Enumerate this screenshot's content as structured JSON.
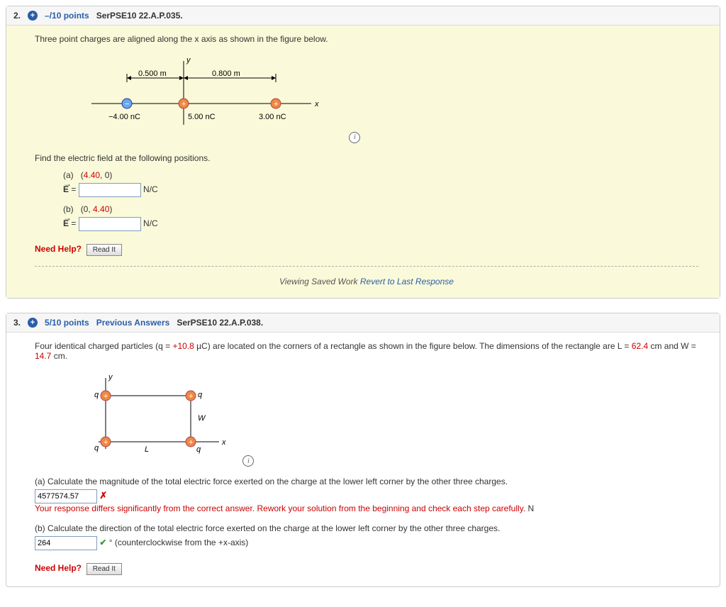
{
  "q2": {
    "number": "2.",
    "points": "–/10 points",
    "serial": "SerPSE10 22.A.P.035.",
    "intro": "Three point charges are aligned along the x axis as shown in the figure below.",
    "fig": {
      "d1": "0.500 m",
      "d2": "0.800 m",
      "c1": "−4.00 nC",
      "c2": "5.00 nC",
      "c3": "3.00 nC",
      "x": "x",
      "y": "y"
    },
    "find": "Find the electric field at the following positions.",
    "partA_label": "(a)",
    "partA_point_pre": "(",
    "partA_point_x": "4.40",
    "partA_point_rest": ", 0)",
    "partB_label": "(b)",
    "partB_point_pre": "(0, ",
    "partB_point_y": "4.40",
    "partB_point_suf": ")",
    "E_label": "E⃗ =",
    "unit": "N/C",
    "needHelp": "Need Help?",
    "readIt": "Read It",
    "revert_pre": "Viewing Saved Work ",
    "revert_link": "Revert to Last Response"
  },
  "q3": {
    "number": "3.",
    "points": "5/10 points",
    "prev": "Previous Answers",
    "serial": "SerPSE10 22.A.P.038.",
    "intro_pre": "Four identical charged particles (q = ",
    "q_val": "+10.8",
    "intro_mid1": " µC) are located on the corners of a rectangle as shown in the figure below. The dimensions of the rectangle are L = ",
    "L_val": "62.4",
    "intro_mid2": " cm and W = ",
    "W_val": "14.7",
    "intro_end": " cm.",
    "fig": {
      "q": "q",
      "L": "L",
      "W": "W",
      "x": "x",
      "y": "y"
    },
    "partA": "(a) Calculate the magnitude of the total electric force exerted on the charge at the lower left corner by the other three charges.",
    "partA_value": "4577574.57",
    "partA_unit": "N",
    "partA_error": "Your response differs significantly from the correct answer. Rework your solution from the beginning and check each step carefully.",
    "partB": "(b) Calculate the direction of the total electric force exerted on the charge at the lower left corner by the other three charges.",
    "partB_value": "264",
    "partB_unit": "° (counterclockwise from the +x-axis)",
    "needHelp": "Need Help?",
    "readIt": "Read It"
  }
}
